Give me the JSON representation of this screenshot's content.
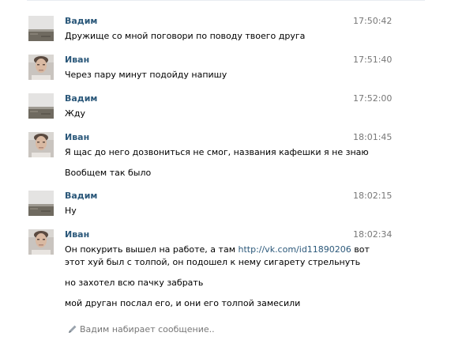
{
  "messages": [
    {
      "author": "Вадим",
      "time": "17:50:42",
      "avatar": "landscape-photo",
      "lines": [
        "Дружище со мной поговори по поводу твоего друга"
      ]
    },
    {
      "author": "Иван",
      "time": "17:51:40",
      "avatar": "face-photo",
      "lines": [
        "Через пару минут подойду напишу"
      ]
    },
    {
      "author": "Вадим",
      "time": "17:52:00",
      "avatar": "landscape-photo",
      "lines": [
        "Жду"
      ]
    },
    {
      "author": "Иван",
      "time": "18:01:45",
      "avatar": "face-photo",
      "lines": [
        "Я щас до него дозвониться не смог, названия кафешки я не знаю",
        "Вообщем так было"
      ]
    },
    {
      "author": "Вадим",
      "time": "18:02:15",
      "avatar": "landscape-photo",
      "lines": [
        "Ну"
      ]
    },
    {
      "author": "Иван",
      "time": "18:02:34",
      "avatar": "face-photo",
      "line1_before": "Он покурить вышел на работе, а там ",
      "link": "http://vk.com/id11890206",
      "line1_after": " вот",
      "line2": "этот хуй был с толпой, он подошел к нему сигарету стрельнуть",
      "line3": "но захотел всю пачку забрать",
      "line4": "мой друган послал его, и они его толпой замесили"
    }
  ],
  "typing_indicator": {
    "icon": "pencil-icon",
    "text": "Вадим набирает сообщение.."
  },
  "colors": {
    "author_name": "#2b587a",
    "timestamp": "#777777",
    "link": "#2b587a",
    "text": "#000000"
  }
}
